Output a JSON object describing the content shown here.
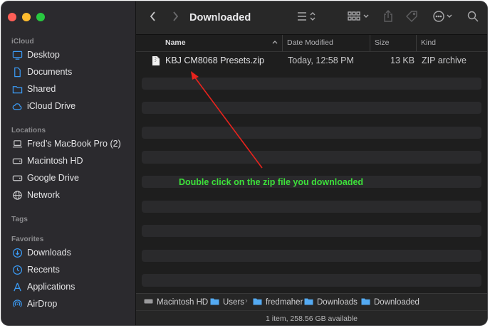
{
  "window": {
    "title": "Downloaded"
  },
  "sidebar": {
    "sections": [
      {
        "label": "iCloud",
        "items": [
          {
            "label": "Desktop",
            "icon": "desktop-icon"
          },
          {
            "label": "Documents",
            "icon": "document-icon"
          },
          {
            "label": "Shared",
            "icon": "shared-folder-icon"
          },
          {
            "label": "iCloud Drive",
            "icon": "cloud-icon"
          }
        ]
      },
      {
        "label": "Locations",
        "items": [
          {
            "label": "Fred’s MacBook Pro (2)",
            "icon": "laptop-icon"
          },
          {
            "label": "Macintosh HD",
            "icon": "disk-icon"
          },
          {
            "label": "Google Drive",
            "icon": "disk-icon"
          },
          {
            "label": "Network",
            "icon": "globe-icon"
          }
        ]
      },
      {
        "label": "Tags",
        "items": []
      },
      {
        "label": "Favorites",
        "items": [
          {
            "label": "Downloads",
            "icon": "download-icon"
          },
          {
            "label": "Recents",
            "icon": "clock-icon"
          },
          {
            "label": "Applications",
            "icon": "applications-icon"
          },
          {
            "label": "AirDrop",
            "icon": "airdrop-icon"
          }
        ]
      }
    ]
  },
  "columns": {
    "name": "Name",
    "date": "Date Modified",
    "size": "Size",
    "kind": "Kind"
  },
  "files": [
    {
      "name": "KBJ CM8068 Presets.zip",
      "date": "Today, 12:58 PM",
      "size": "13 KB",
      "kind": "ZIP archive",
      "icon": "zip-file-icon"
    }
  ],
  "annotation": {
    "text": "Double click on the zip file you downloaded",
    "color": "#3de03a"
  },
  "path": [
    "Macintosh HD",
    "Users",
    "fredmaher",
    "Downloads",
    "Downloaded"
  ],
  "status": "1 item, 258.56 GB available",
  "colors": {
    "close": "#fe5f57",
    "minimize": "#febc2e",
    "zoom": "#28c840",
    "sidebar_icon": "#3b9bf5"
  }
}
